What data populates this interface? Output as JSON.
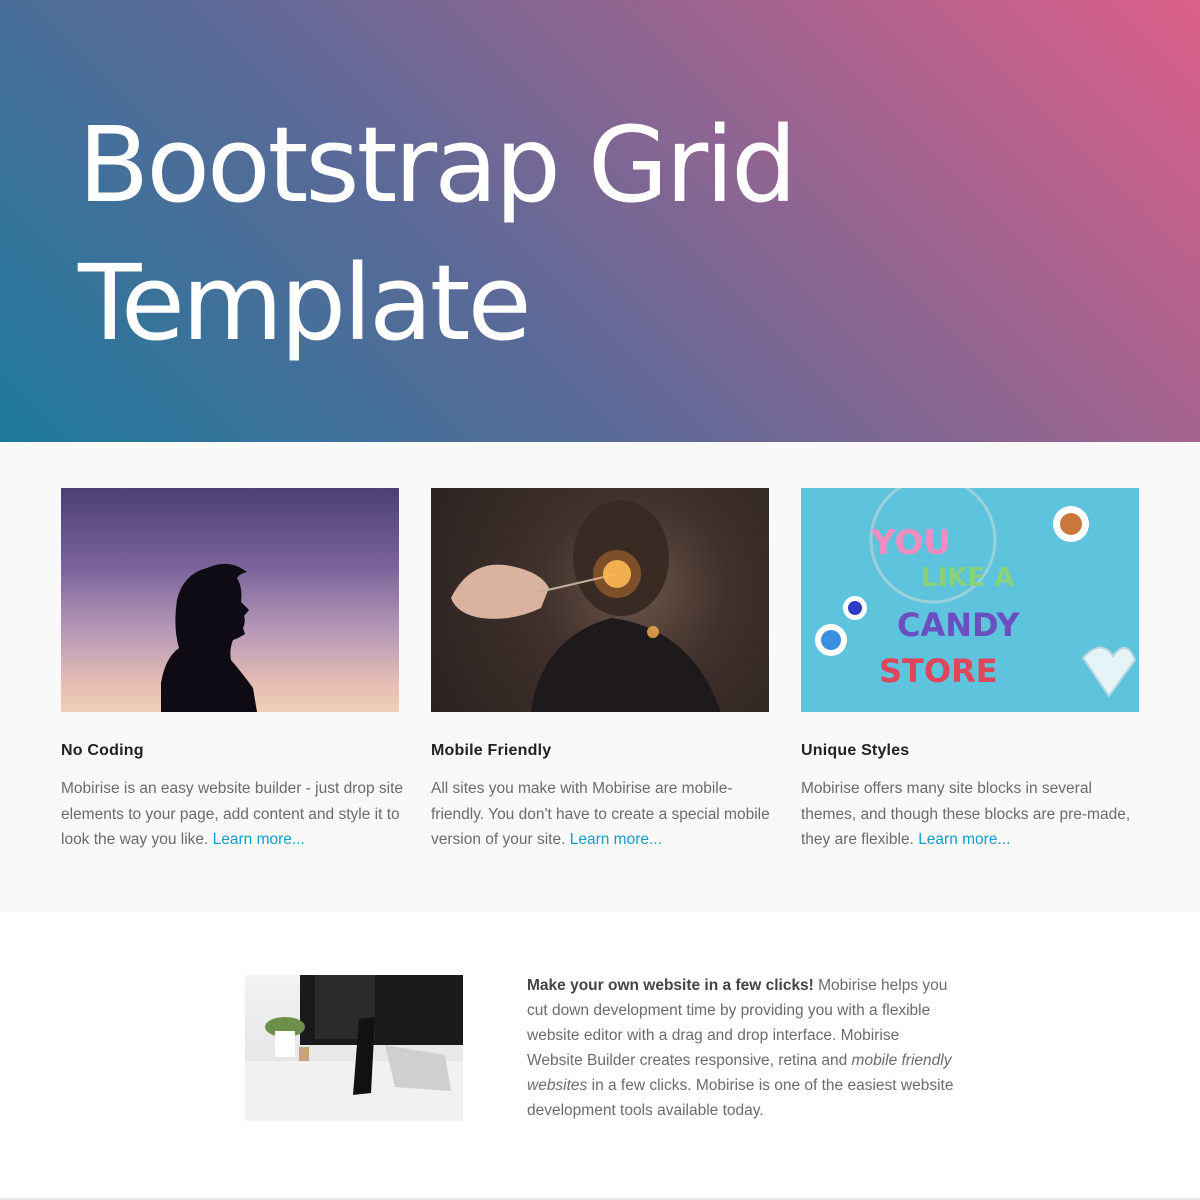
{
  "hero": {
    "title_line1": "Bootstrap Grid",
    "title_line2": "Template",
    "gradient_colors": [
      "#1e7a9c",
      "#5a6a98",
      "#9a6490",
      "#dc5f89"
    ]
  },
  "features": {
    "cards": [
      {
        "title": "No Coding",
        "text": "Mobirise is an easy website builder - just drop site elements to your page, add content and style it to look the way you like.",
        "link": "Learn more..."
      },
      {
        "title": "Mobile Friendly",
        "text": "All sites you make with Mobirise are mobile-friendly. You don't have to create a special mobile version of your site.",
        "link": "Learn more..."
      },
      {
        "title": "Unique Styles",
        "text": "Mobirise offers many site blocks in several themes, and though these blocks are pre-made, they are flexible.",
        "link": "Learn more..."
      }
    ],
    "candy_letters": {
      "line1": "YOU",
      "line2": "LIKE A",
      "line3": "CANDY",
      "line4": "STORE"
    }
  },
  "about": {
    "bold": "Make your own website in a few clicks!",
    "text1": " Mobirise helps you cut down development time by providing you with a flexible website editor with a drag and drop interface. Mobirise Website Builder creates responsive, retina and ",
    "italic": "mobile friendly websites",
    "text2": " in a few clicks. Mobirise is one of the easiest website development tools available today."
  },
  "colors": {
    "link": "#149dcc",
    "section_bg": "#f9f9f9"
  }
}
